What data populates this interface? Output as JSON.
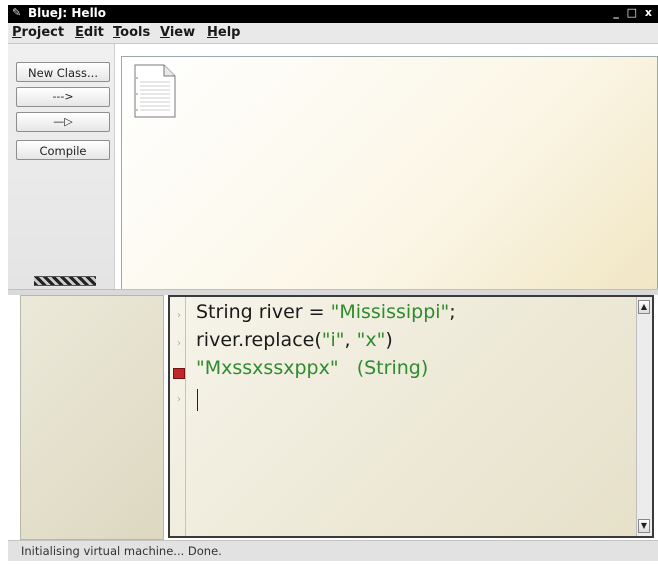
{
  "window": {
    "title": "BlueJ: Hello",
    "controls": "_ □ x"
  },
  "menu": {
    "items": [
      {
        "label": "Project",
        "mnemonic": "P",
        "rest": "roject"
      },
      {
        "label": "Edit",
        "mnemonic": "E",
        "rest": "dit"
      },
      {
        "label": "Tools",
        "mnemonic": "T",
        "rest": "ools"
      },
      {
        "label": "View",
        "mnemonic": "V",
        "rest": "iew"
      },
      {
        "label": "Help",
        "mnemonic": "H",
        "rest": "elp"
      }
    ]
  },
  "toolbar": {
    "new_class": "New Class...",
    "uses_arrow": "--->",
    "inheritance_arrow": "—▷",
    "compile": "Compile"
  },
  "diagram": {
    "icons": [
      "readme-document-icon"
    ]
  },
  "codepad": {
    "line1_code": "String river = ",
    "line1_str": "\"Mississippi\"",
    "line1_end": ";",
    "line2_a": "river.replace(",
    "line2_s1": "\"i\"",
    "line2_sep": ", ",
    "line2_s2": "\"x\"",
    "line2_end": ")",
    "result_value": "\"Mxssxssxppx\"",
    "result_type": "(String)"
  },
  "status": {
    "text": "Initialising virtual machine... Done."
  },
  "colors": {
    "string_green": "#2e8b2e",
    "error_red": "#c0272d"
  }
}
